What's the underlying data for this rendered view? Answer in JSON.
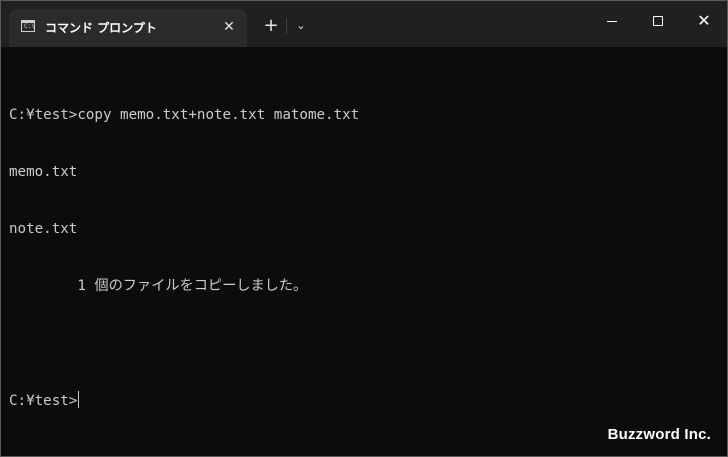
{
  "window": {
    "tab_title": "コマンド プロンプト",
    "tab_icon": "terminal-icon",
    "tab_icon_text": "C:\\",
    "tab_close": "✕",
    "new_tab": "+",
    "dropdown": "⌄",
    "close_glyph": "✕"
  },
  "console": {
    "lines": [
      "C:¥test>copy memo.txt+note.txt matome.txt",
      "memo.txt",
      "note.txt",
      "        1 個のファイルをコピーしました。",
      "",
      "C:¥test>"
    ]
  },
  "watermark": "Buzzword Inc.",
  "colors": {
    "background": "#0c0c0c",
    "titlebar": "#202020",
    "active_tab": "#2b2b2b",
    "text": "#cccccc"
  }
}
